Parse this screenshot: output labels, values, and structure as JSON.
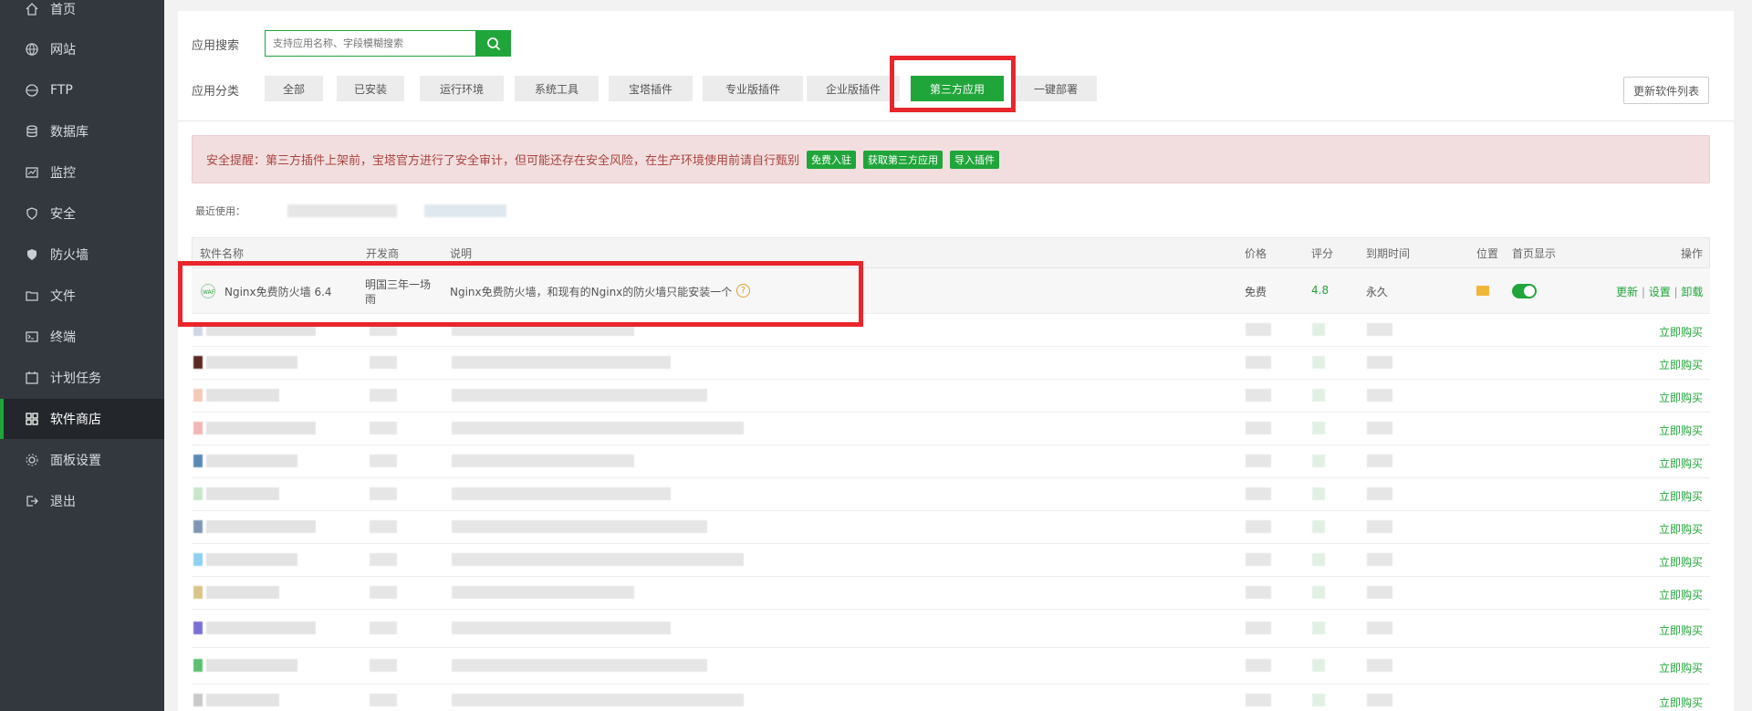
{
  "sidebar": {
    "items": [
      {
        "label": "首页",
        "icon": "home-icon"
      },
      {
        "label": "网站",
        "icon": "globe-icon"
      },
      {
        "label": "FTP",
        "icon": "ftp-icon"
      },
      {
        "label": "数据库",
        "icon": "database-icon"
      },
      {
        "label": "监控",
        "icon": "monitor-icon"
      },
      {
        "label": "安全",
        "icon": "shield-icon"
      },
      {
        "label": "防火墙",
        "icon": "firewall-icon"
      },
      {
        "label": "文件",
        "icon": "folder-icon"
      },
      {
        "label": "终端",
        "icon": "terminal-icon"
      },
      {
        "label": "计划任务",
        "icon": "clock-icon"
      },
      {
        "label": "软件商店",
        "icon": "apps-icon"
      },
      {
        "label": "面板设置",
        "icon": "gear-icon"
      },
      {
        "label": "退出",
        "icon": "logout-icon"
      }
    ],
    "active_index": 10,
    "active_color": "#20a53a"
  },
  "search": {
    "label": "应用搜索",
    "placeholder": "支持应用名称、字段模糊搜索"
  },
  "categories": {
    "label": "应用分类",
    "items": [
      "全部",
      "已安装",
      "运行环境",
      "系统工具",
      "宝塔插件",
      "专业版插件",
      "企业版插件",
      "第三方应用",
      "一键部署"
    ],
    "active": "第三方应用"
  },
  "refresh_label": "更新软件列表",
  "alert": {
    "text": "安全提醒：第三方插件上架前，宝塔官方进行了安全审计，但可能还存在安全风险，在生产环境使用前请自行甄别",
    "buttons": [
      "免费入驻",
      "获取第三方应用",
      "导入插件"
    ]
  },
  "recent_label": "最近使用：",
  "table": {
    "headers": {
      "name": "软件名称",
      "developer": "开发商",
      "desc": "说明",
      "price": "价格",
      "rating": "评分",
      "expire": "到期时间",
      "location": "位置",
      "homepage": "首页显示",
      "ops": "操作"
    },
    "first_row": {
      "name": "Nginx免费防火墙 6.4",
      "developer": "明国三年一场雨",
      "desc": "Nginx免费防火墙，和现有的Nginx的防火墙只能安装一个",
      "price": "免费",
      "rating": "4.8",
      "expire": "永久",
      "ops": [
        "更新",
        "设置",
        "卸载"
      ],
      "homepage_enabled": true
    },
    "buy_label": "立即购买",
    "other_rows_visible": 12
  },
  "colors": {
    "accent": "#20a53a",
    "highlight": "#e8262c",
    "sidebar_bg": "#33383e"
  }
}
